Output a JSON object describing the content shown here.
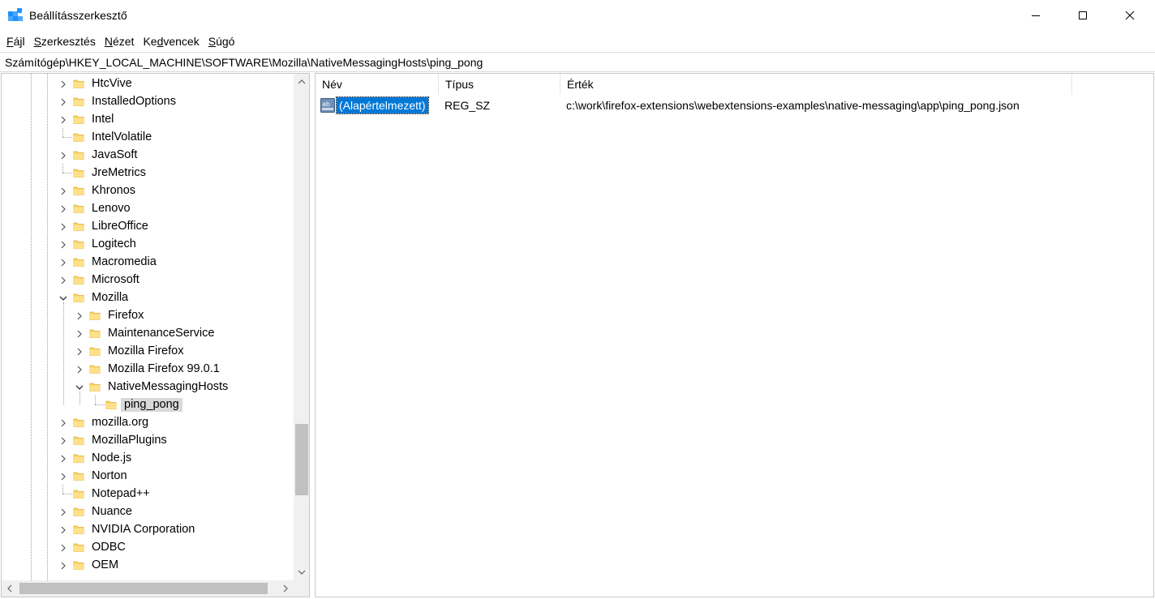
{
  "window": {
    "title": "Beállításszerkesztő"
  },
  "menu": [
    {
      "label": "Fájl",
      "hotkey": "F",
      "rest": "ájl"
    },
    {
      "label": "Szerkesztés",
      "hotkey": "S",
      "rest": "zerkesztés"
    },
    {
      "label": "Nézet",
      "hotkey": "N",
      "rest": "ézet"
    },
    {
      "label": "Kedvencek",
      "hotkey": "Ke",
      "rest": "dvencek",
      "pre": "Ke",
      "mid": "d",
      "post": "vencek"
    },
    {
      "label": "Súgó",
      "hotkey": "S",
      "rest": "úgó"
    }
  ],
  "address": {
    "path": "Számítógép\\HKEY_LOCAL_MACHINE\\SOFTWARE\\Mozilla\\NativeMessagingHosts\\ping_pong"
  },
  "tree": [
    {
      "label": "HtcVive",
      "depth": 0,
      "expander": "collapsed"
    },
    {
      "label": "InstalledOptions",
      "depth": 0,
      "expander": "collapsed"
    },
    {
      "label": "Intel",
      "depth": 0,
      "expander": "collapsed"
    },
    {
      "label": "IntelVolatile",
      "depth": 0,
      "expander": "none"
    },
    {
      "label": "JavaSoft",
      "depth": 0,
      "expander": "collapsed"
    },
    {
      "label": "JreMetrics",
      "depth": 0,
      "expander": "none"
    },
    {
      "label": "Khronos",
      "depth": 0,
      "expander": "collapsed"
    },
    {
      "label": "Lenovo",
      "depth": 0,
      "expander": "collapsed"
    },
    {
      "label": "LibreOffice",
      "depth": 0,
      "expander": "collapsed"
    },
    {
      "label": "Logitech",
      "depth": 0,
      "expander": "collapsed"
    },
    {
      "label": "Macromedia",
      "depth": 0,
      "expander": "collapsed"
    },
    {
      "label": "Microsoft",
      "depth": 0,
      "expander": "collapsed"
    },
    {
      "label": "Mozilla",
      "depth": 0,
      "expander": "expanded"
    },
    {
      "label": "Firefox",
      "depth": 1,
      "expander": "collapsed"
    },
    {
      "label": "MaintenanceService",
      "depth": 1,
      "expander": "collapsed"
    },
    {
      "label": "Mozilla Firefox",
      "depth": 1,
      "expander": "collapsed"
    },
    {
      "label": "Mozilla Firefox 99.0.1",
      "depth": 1,
      "expander": "collapsed"
    },
    {
      "label": "NativeMessagingHosts",
      "depth": 1,
      "expander": "expanded"
    },
    {
      "label": "ping_pong",
      "depth": 2,
      "expander": "none",
      "selected": true
    },
    {
      "label": "mozilla.org",
      "depth": 0,
      "expander": "collapsed"
    },
    {
      "label": "MozillaPlugins",
      "depth": 0,
      "expander": "collapsed"
    },
    {
      "label": "Node.js",
      "depth": 0,
      "expander": "collapsed"
    },
    {
      "label": "Norton",
      "depth": 0,
      "expander": "collapsed"
    },
    {
      "label": "Notepad++",
      "depth": 0,
      "expander": "none"
    },
    {
      "label": "Nuance",
      "depth": 0,
      "expander": "collapsed"
    },
    {
      "label": "NVIDIA Corporation",
      "depth": 0,
      "expander": "collapsed"
    },
    {
      "label": "ODBC",
      "depth": 0,
      "expander": "collapsed"
    },
    {
      "label": "OEM",
      "depth": 0,
      "expander": "collapsed"
    }
  ],
  "list": {
    "columns": [
      "Név",
      "Típus",
      "Érték"
    ],
    "rows": [
      {
        "name": "(Alapértelmezett)",
        "type": "REG_SZ",
        "value": "c:\\work\\firefox-extensions\\webextensions-examples\\native-messaging\\app\\ping_pong.json",
        "icon": "string-value-icon",
        "selected": true
      }
    ]
  },
  "icons": {
    "app": "registry-editor-icon",
    "folder": "folder-icon",
    "expand": "chevron-right-icon",
    "collapse": "chevron-down-icon"
  },
  "colors": {
    "selection": "#0078d7",
    "folder": "#ffd45c",
    "tree_selected": "#d9d9d9"
  }
}
